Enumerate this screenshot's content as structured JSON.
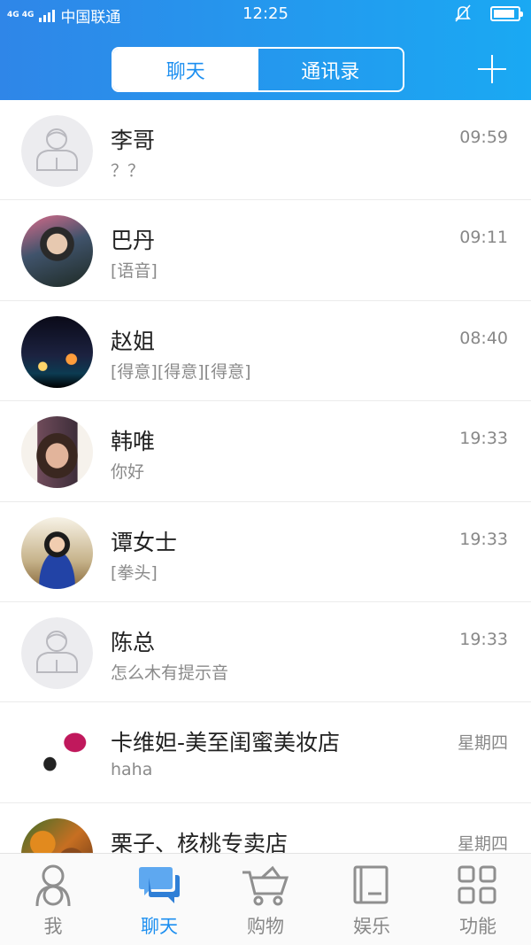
{
  "status_bar": {
    "network": "4G 4G",
    "carrier": "中国联通",
    "time": "12:25",
    "battery_level": 0.9
  },
  "header": {
    "tabs": [
      {
        "label": "聊天",
        "active": true
      },
      {
        "label": "通讯录",
        "active": false
      }
    ],
    "add_icon": "plus-icon"
  },
  "chats": [
    {
      "name": "李哥",
      "message": "？？",
      "time": "09:59",
      "avatar": "default-avatar"
    },
    {
      "name": "巴丹",
      "message": "[语音]",
      "time": "09:11",
      "avatar": "photo-avatar"
    },
    {
      "name": "赵姐",
      "message": "[得意][得意][得意]",
      "time": "08:40",
      "avatar": "photo-avatar"
    },
    {
      "name": "韩唯",
      "message": "你好",
      "time": "19:33",
      "avatar": "photo-avatar"
    },
    {
      "name": "谭女士",
      "message": "[拳头]",
      "time": "19:33",
      "avatar": "photo-avatar"
    },
    {
      "name": "陈总",
      "message": "怎么木有提示音",
      "time": "19:33",
      "avatar": "default-avatar"
    },
    {
      "name": "卡维妲-美至闺蜜美妆店",
      "message": "haha",
      "time": "星期四",
      "avatar": "photo-avatar"
    },
    {
      "name": "栗子、核桃专卖店",
      "message": "",
      "time": "星期四",
      "avatar": "photo-avatar"
    }
  ],
  "bottom_nav": [
    {
      "label": "我",
      "icon": "person-icon",
      "active": false
    },
    {
      "label": "聊天",
      "icon": "chat-icon",
      "active": true
    },
    {
      "label": "购物",
      "icon": "cart-icon",
      "active": false
    },
    {
      "label": "娱乐",
      "icon": "book-icon",
      "active": false
    },
    {
      "label": "功能",
      "icon": "apps-icon",
      "active": false
    }
  ],
  "colors": {
    "header_start": "#2f86e8",
    "header_end": "#1aa9f3",
    "accent": "#1d8ff0"
  }
}
